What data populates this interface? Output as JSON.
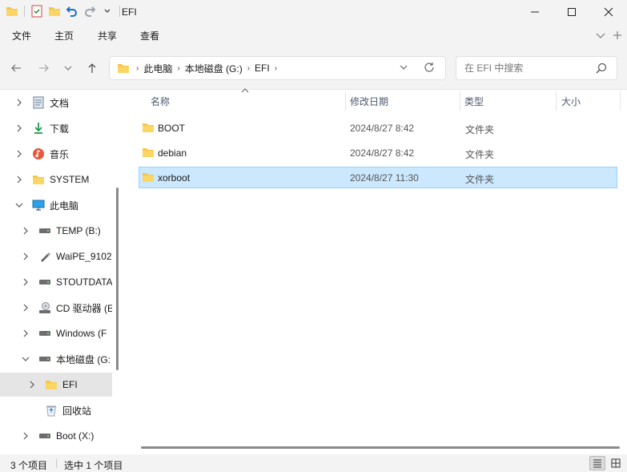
{
  "window": {
    "title": "EFI"
  },
  "ribbon": {
    "tabs": [
      "文件",
      "主页",
      "共享",
      "查看"
    ]
  },
  "address": {
    "crumbs": [
      "此电脑",
      "本地磁盘 (G:)",
      "EFI"
    ]
  },
  "search": {
    "placeholder": "在 EFI 中搜索"
  },
  "sidebar": {
    "items": [
      {
        "label": "文档",
        "icon": "documents-icon"
      },
      {
        "label": "下载",
        "icon": "downloads-icon"
      },
      {
        "label": "音乐",
        "icon": "music-icon"
      },
      {
        "label": "SYSTEM",
        "icon": "folder-icon"
      },
      {
        "label": "此电脑",
        "icon": "this-pc-icon"
      },
      {
        "label": "TEMP (B:)",
        "icon": "drive-icon"
      },
      {
        "label": "WaiPE_9102",
        "icon": "usb-drive-icon"
      },
      {
        "label": "STOUTDATA",
        "icon": "drive-icon"
      },
      {
        "label": "CD 驱动器 (E",
        "icon": "cd-drive-icon"
      },
      {
        "label": "Windows (F",
        "icon": "drive-icon"
      },
      {
        "label": "本地磁盘 (G:",
        "icon": "drive-icon"
      },
      {
        "label": "EFI",
        "icon": "folder-icon"
      },
      {
        "label": "回收站",
        "icon": "recycle-bin-icon"
      },
      {
        "label": "Boot (X:)",
        "icon": "drive-icon"
      }
    ]
  },
  "columns": {
    "name": "名称",
    "modified": "修改日期",
    "type": "类型",
    "size": "大小"
  },
  "files": [
    {
      "name": "BOOT",
      "modified": "2024/8/27 8:42",
      "type": "文件夹",
      "size": ""
    },
    {
      "name": "debian",
      "modified": "2024/8/27 8:42",
      "type": "文件夹",
      "size": ""
    },
    {
      "name": "xorboot",
      "modified": "2024/8/27 11:30",
      "type": "文件夹",
      "size": ""
    }
  ],
  "status": {
    "item_count": "3 个项目",
    "selected": "选中 1 个项目"
  },
  "colors": {
    "folder": "#f6c544",
    "selection_bg": "#cce8ff",
    "selection_border": "#99d1ff",
    "chrome_bg": "#f3f3f3"
  }
}
